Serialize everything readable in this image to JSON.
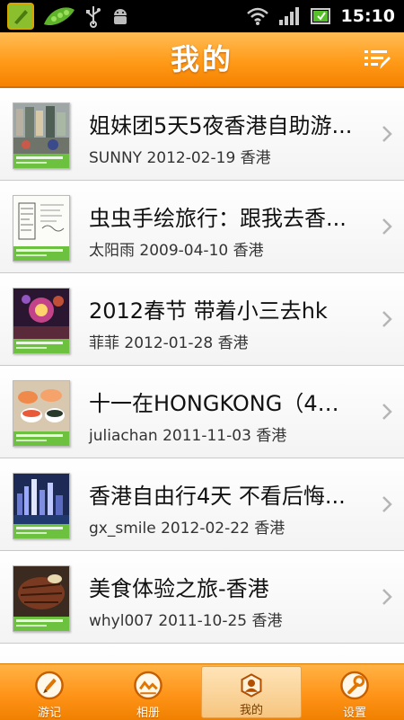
{
  "status_bar": {
    "time": "15:10",
    "icons": [
      "app-icon",
      "pea-pod-icon",
      "usb-icon",
      "android-debug-icon",
      "wifi-icon",
      "signal-icon",
      "battery-icon"
    ]
  },
  "header": {
    "title": "我的",
    "menu_icon": "edit-list-icon"
  },
  "trips": [
    {
      "title": "姐妹团5天5夜香港自助游...",
      "author": "SUNNY",
      "date": "2012-02-19",
      "place": "香港"
    },
    {
      "title": "虫虫手绘旅行：跟我去香...",
      "author": "太阳雨",
      "date": "2009-04-10",
      "place": "香港"
    },
    {
      "title": "2012春节 带着小三去hk",
      "author": "菲菲",
      "date": "2012-01-28",
      "place": "香港"
    },
    {
      "title": "十一在HONGKONG（4天...",
      "author": "juliachan",
      "date": "2011-11-03",
      "place": "香港"
    },
    {
      "title": "香港自由行4天 不看后悔...",
      "author": "gx_smile",
      "date": "2012-02-22",
      "place": "香港"
    },
    {
      "title": "美食体验之旅-香港",
      "author": "whyl007",
      "date": "2011-10-25",
      "place": "香港"
    }
  ],
  "tabs": [
    {
      "label": "游记",
      "icon": "pen-icon",
      "active": false
    },
    {
      "label": "相册",
      "icon": "photo-album-icon",
      "active": false
    },
    {
      "label": "我的",
      "icon": "user-icon",
      "active": true
    },
    {
      "label": "设置",
      "icon": "wrench-icon",
      "active": false
    }
  ],
  "colors": {
    "accent": "#ff9a18",
    "tab_active": "#f6c57f",
    "thumb_band": "#6cc23f"
  }
}
